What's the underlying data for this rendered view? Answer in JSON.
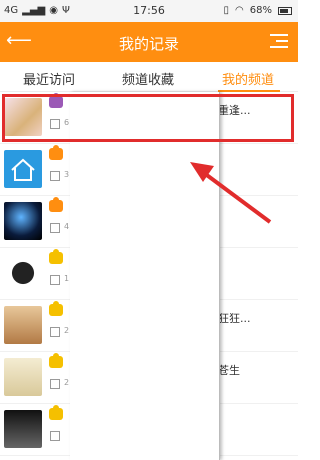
{
  "status_bar": {
    "signal": "4G",
    "time": "17:56",
    "battery": "68%"
  },
  "header": {
    "title": "我的记录",
    "back_icon": "back-arrow-icon",
    "menu_icon": "menu-list-icon"
  },
  "tabs": [
    {
      "label": "最近访问",
      "active": false
    },
    {
      "label": "频道收藏",
      "active": false
    },
    {
      "label": "我的频道",
      "active": true
    }
  ],
  "rows": [
    {
      "badge_color": "#9b59b6",
      "num": "6",
      "right_text": "重逢..."
    },
    {
      "badge_color": "#ff8e10",
      "num": "3",
      "right_text": ""
    },
    {
      "badge_color": "#ff8e10",
      "num": "4",
      "right_text": ""
    },
    {
      "badge_color": "#f5c000",
      "num": "1",
      "right_text": ""
    },
    {
      "badge_color": "#f5c000",
      "num": "2",
      "right_text": "狂狂..."
    },
    {
      "badge_color": "#f5c000",
      "num": "2",
      "right_text": "苍生"
    },
    {
      "badge_color": "#f5c000",
      "num": "",
      "right_text": ""
    }
  ],
  "colors": {
    "accent": "#ff8e10",
    "highlight": "#e12c2c"
  }
}
